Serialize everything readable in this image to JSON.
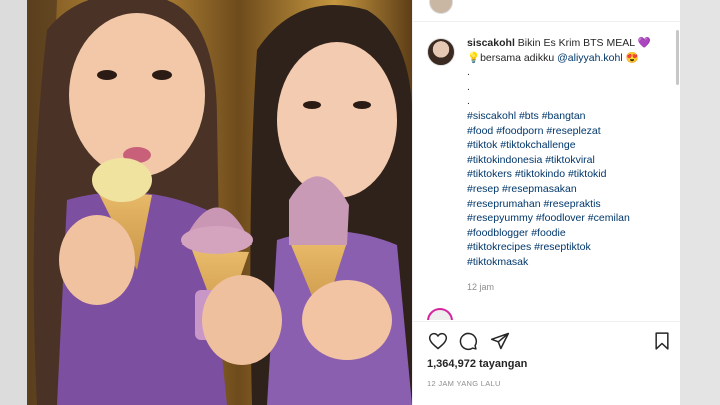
{
  "post": {
    "username": "siscakohl",
    "caption_title": "Bikin Es Krim BTS MEAL 💜",
    "caption_line2": "💡bersama adikku ",
    "mention": "@aliyyah.kohl",
    "mention_emoji": " 😍",
    "dots": [
      ".",
      ".",
      "."
    ],
    "hashtag_lines": [
      "#siscakohl #bts #bangtan",
      "#food #foodporn #reseplezat",
      "#tiktok #tiktokchallenge",
      "#tiktokindonesia #tiktokviral",
      "#tiktokers #tiktokindo #tiktokid",
      "#resep #resepmasakan",
      "#reseprumahan #resepraktis",
      "#resepyummy #foodlover #cemilan",
      "#foodblogger #foodie",
      "#tiktokrecipes #reseptiktok",
      "#tiktokmasak"
    ],
    "caption_age": "12 jam",
    "views": "1,364,972 tayangan",
    "timestamp": "12 JAM YANG LALU"
  },
  "icons": {
    "like": "heart-icon",
    "comment": "comment-icon",
    "share": "paper-plane-icon",
    "save": "bookmark-icon"
  },
  "colors": {
    "hashtag": "#00376b",
    "text": "#262626",
    "muted": "#8e8e8e"
  }
}
